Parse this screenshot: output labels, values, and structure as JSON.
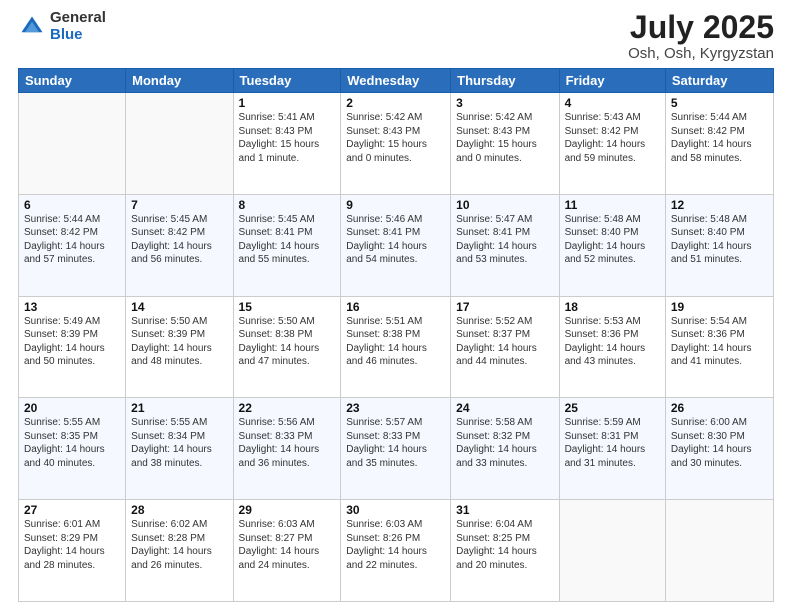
{
  "logo": {
    "general": "General",
    "blue": "Blue"
  },
  "header": {
    "month": "July 2025",
    "location": "Osh, Osh, Kyrgyzstan"
  },
  "days_of_week": [
    "Sunday",
    "Monday",
    "Tuesday",
    "Wednesday",
    "Thursday",
    "Friday",
    "Saturday"
  ],
  "weeks": [
    [
      {
        "day": "",
        "detail": ""
      },
      {
        "day": "",
        "detail": ""
      },
      {
        "day": "1",
        "detail": "Sunrise: 5:41 AM\nSunset: 8:43 PM\nDaylight: 15 hours\nand 1 minute."
      },
      {
        "day": "2",
        "detail": "Sunrise: 5:42 AM\nSunset: 8:43 PM\nDaylight: 15 hours\nand 0 minutes."
      },
      {
        "day": "3",
        "detail": "Sunrise: 5:42 AM\nSunset: 8:43 PM\nDaylight: 15 hours\nand 0 minutes."
      },
      {
        "day": "4",
        "detail": "Sunrise: 5:43 AM\nSunset: 8:42 PM\nDaylight: 14 hours\nand 59 minutes."
      },
      {
        "day": "5",
        "detail": "Sunrise: 5:44 AM\nSunset: 8:42 PM\nDaylight: 14 hours\nand 58 minutes."
      }
    ],
    [
      {
        "day": "6",
        "detail": "Sunrise: 5:44 AM\nSunset: 8:42 PM\nDaylight: 14 hours\nand 57 minutes."
      },
      {
        "day": "7",
        "detail": "Sunrise: 5:45 AM\nSunset: 8:42 PM\nDaylight: 14 hours\nand 56 minutes."
      },
      {
        "day": "8",
        "detail": "Sunrise: 5:45 AM\nSunset: 8:41 PM\nDaylight: 14 hours\nand 55 minutes."
      },
      {
        "day": "9",
        "detail": "Sunrise: 5:46 AM\nSunset: 8:41 PM\nDaylight: 14 hours\nand 54 minutes."
      },
      {
        "day": "10",
        "detail": "Sunrise: 5:47 AM\nSunset: 8:41 PM\nDaylight: 14 hours\nand 53 minutes."
      },
      {
        "day": "11",
        "detail": "Sunrise: 5:48 AM\nSunset: 8:40 PM\nDaylight: 14 hours\nand 52 minutes."
      },
      {
        "day": "12",
        "detail": "Sunrise: 5:48 AM\nSunset: 8:40 PM\nDaylight: 14 hours\nand 51 minutes."
      }
    ],
    [
      {
        "day": "13",
        "detail": "Sunrise: 5:49 AM\nSunset: 8:39 PM\nDaylight: 14 hours\nand 50 minutes."
      },
      {
        "day": "14",
        "detail": "Sunrise: 5:50 AM\nSunset: 8:39 PM\nDaylight: 14 hours\nand 48 minutes."
      },
      {
        "day": "15",
        "detail": "Sunrise: 5:50 AM\nSunset: 8:38 PM\nDaylight: 14 hours\nand 47 minutes."
      },
      {
        "day": "16",
        "detail": "Sunrise: 5:51 AM\nSunset: 8:38 PM\nDaylight: 14 hours\nand 46 minutes."
      },
      {
        "day": "17",
        "detail": "Sunrise: 5:52 AM\nSunset: 8:37 PM\nDaylight: 14 hours\nand 44 minutes."
      },
      {
        "day": "18",
        "detail": "Sunrise: 5:53 AM\nSunset: 8:36 PM\nDaylight: 14 hours\nand 43 minutes."
      },
      {
        "day": "19",
        "detail": "Sunrise: 5:54 AM\nSunset: 8:36 PM\nDaylight: 14 hours\nand 41 minutes."
      }
    ],
    [
      {
        "day": "20",
        "detail": "Sunrise: 5:55 AM\nSunset: 8:35 PM\nDaylight: 14 hours\nand 40 minutes."
      },
      {
        "day": "21",
        "detail": "Sunrise: 5:55 AM\nSunset: 8:34 PM\nDaylight: 14 hours\nand 38 minutes."
      },
      {
        "day": "22",
        "detail": "Sunrise: 5:56 AM\nSunset: 8:33 PM\nDaylight: 14 hours\nand 36 minutes."
      },
      {
        "day": "23",
        "detail": "Sunrise: 5:57 AM\nSunset: 8:33 PM\nDaylight: 14 hours\nand 35 minutes."
      },
      {
        "day": "24",
        "detail": "Sunrise: 5:58 AM\nSunset: 8:32 PM\nDaylight: 14 hours\nand 33 minutes."
      },
      {
        "day": "25",
        "detail": "Sunrise: 5:59 AM\nSunset: 8:31 PM\nDaylight: 14 hours\nand 31 minutes."
      },
      {
        "day": "26",
        "detail": "Sunrise: 6:00 AM\nSunset: 8:30 PM\nDaylight: 14 hours\nand 30 minutes."
      }
    ],
    [
      {
        "day": "27",
        "detail": "Sunrise: 6:01 AM\nSunset: 8:29 PM\nDaylight: 14 hours\nand 28 minutes."
      },
      {
        "day": "28",
        "detail": "Sunrise: 6:02 AM\nSunset: 8:28 PM\nDaylight: 14 hours\nand 26 minutes."
      },
      {
        "day": "29",
        "detail": "Sunrise: 6:03 AM\nSunset: 8:27 PM\nDaylight: 14 hours\nand 24 minutes."
      },
      {
        "day": "30",
        "detail": "Sunrise: 6:03 AM\nSunset: 8:26 PM\nDaylight: 14 hours\nand 22 minutes."
      },
      {
        "day": "31",
        "detail": "Sunrise: 6:04 AM\nSunset: 8:25 PM\nDaylight: 14 hours\nand 20 minutes."
      },
      {
        "day": "",
        "detail": ""
      },
      {
        "day": "",
        "detail": ""
      }
    ]
  ]
}
